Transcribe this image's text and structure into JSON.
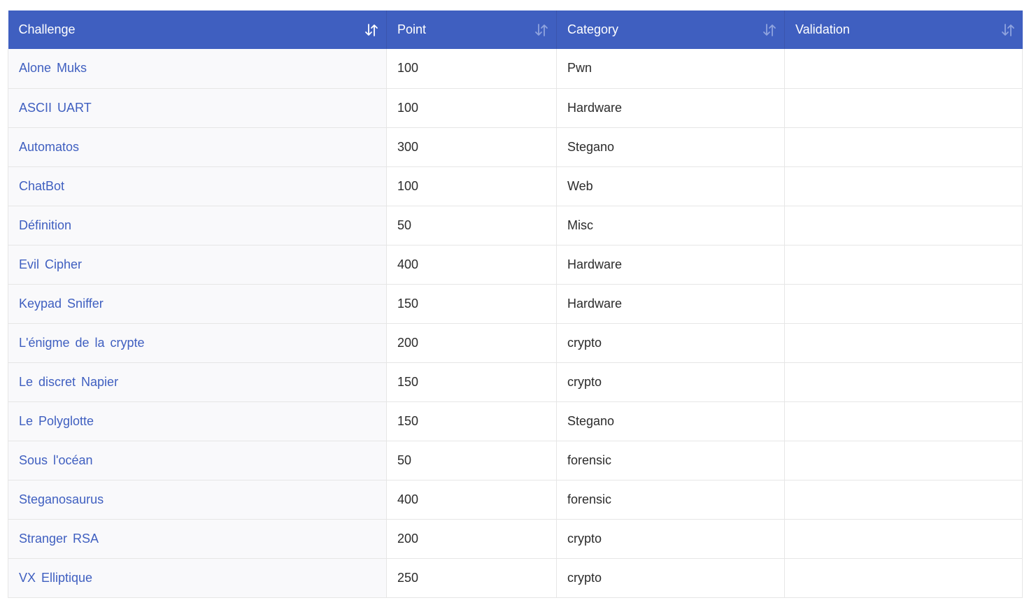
{
  "table": {
    "headers": [
      "Challenge",
      "Point",
      "Category",
      "Validation"
    ],
    "rows": [
      {
        "challenge": "Alone Muks",
        "point": "100",
        "category": "Pwn",
        "validation": ""
      },
      {
        "challenge": "ASCII UART",
        "point": "100",
        "category": "Hardware",
        "validation": ""
      },
      {
        "challenge": "Automatos",
        "point": "300",
        "category": "Stegano",
        "validation": ""
      },
      {
        "challenge": "ChatBot",
        "point": "100",
        "category": "Web",
        "validation": ""
      },
      {
        "challenge": "Définition",
        "point": "50",
        "category": "Misc",
        "validation": ""
      },
      {
        "challenge": "Evil Cipher",
        "point": "400",
        "category": "Hardware",
        "validation": ""
      },
      {
        "challenge": "Keypad Sniffer",
        "point": "150",
        "category": "Hardware",
        "validation": ""
      },
      {
        "challenge": "L'énigme de la crypte",
        "point": "200",
        "category": "crypto",
        "validation": ""
      },
      {
        "challenge": "Le discret Napier",
        "point": "150",
        "category": "crypto",
        "validation": ""
      },
      {
        "challenge": "Le Polyglotte",
        "point": "150",
        "category": "Stegano",
        "validation": ""
      },
      {
        "challenge": "Sous l'océan",
        "point": "50",
        "category": "forensic",
        "validation": ""
      },
      {
        "challenge": "Steganosaurus",
        "point": "400",
        "category": "forensic",
        "validation": ""
      },
      {
        "challenge": "Stranger RSA",
        "point": "200",
        "category": "crypto",
        "validation": ""
      },
      {
        "challenge": "VX Elliptique",
        "point": "250",
        "category": "crypto",
        "validation": ""
      }
    ]
  },
  "sort_icons": {
    "icon": "sort-arrows-icon",
    "active_color": "#ffffff",
    "inactive_color": "#8fa3de"
  },
  "colors": {
    "header_bg": "#3f5fc0",
    "link": "#3f5fc0"
  }
}
